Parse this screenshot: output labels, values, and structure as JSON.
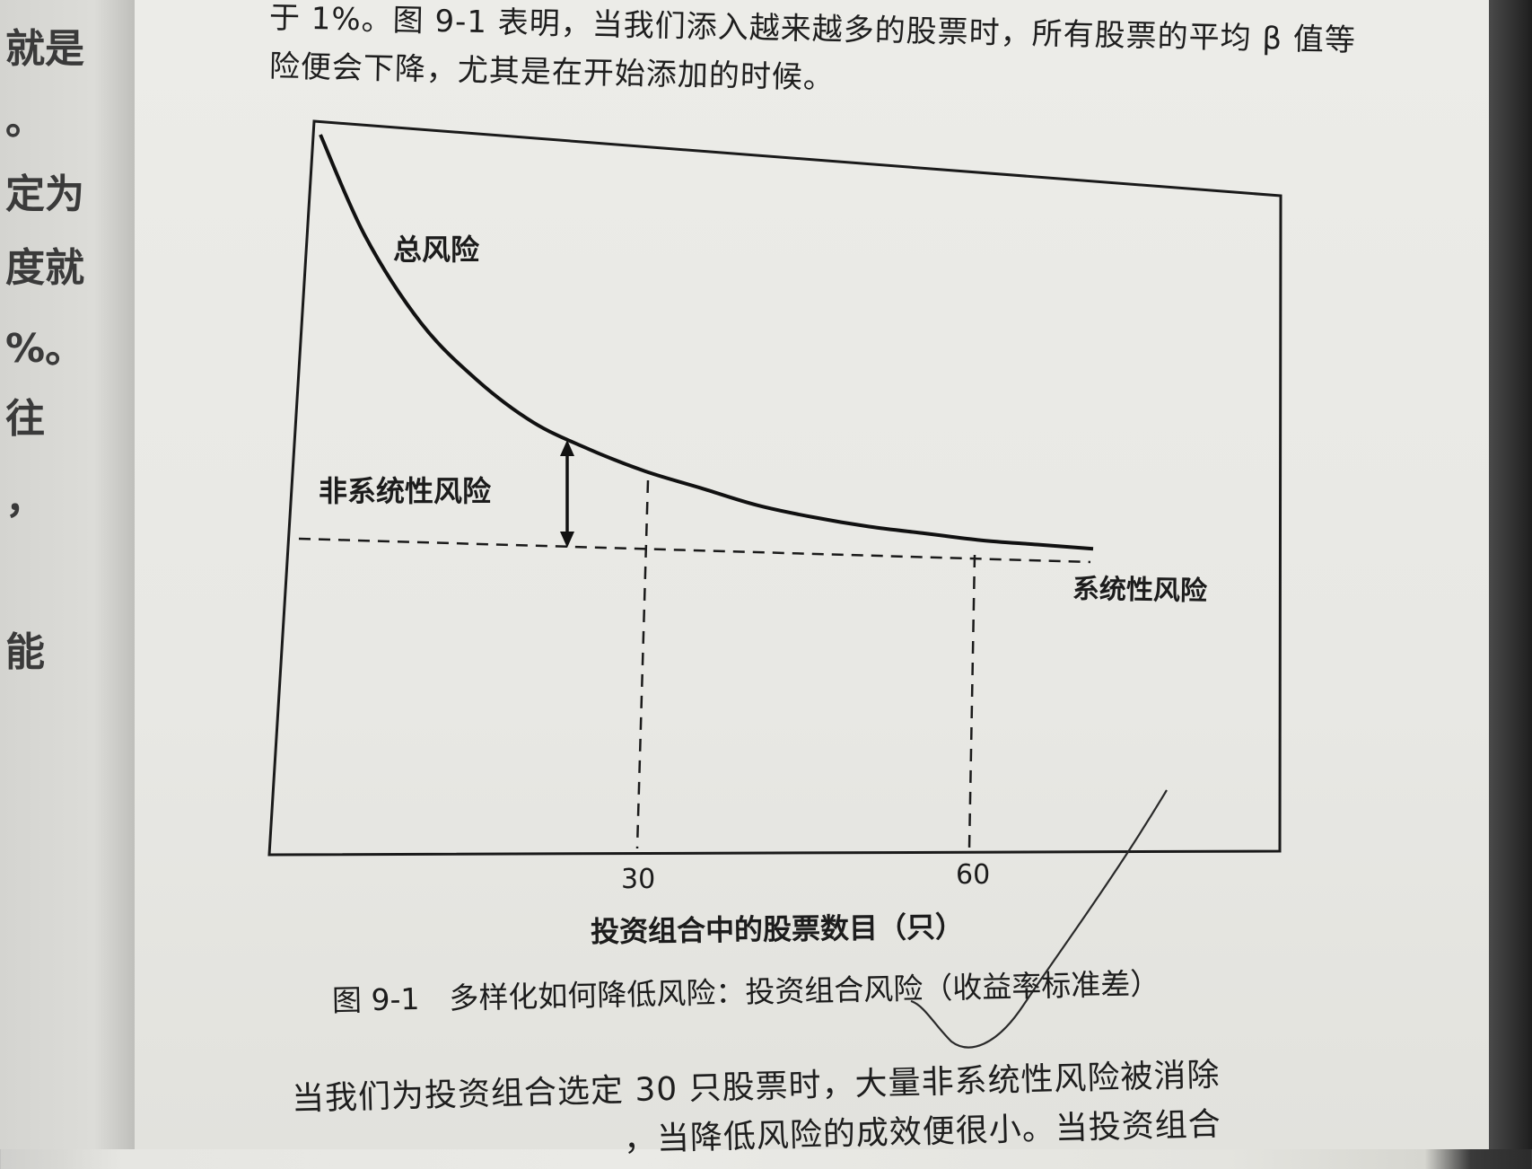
{
  "left_page": {
    "chars": [
      "就是",
      "。",
      "定为",
      "度就",
      "%。",
      "往",
      "，",
      "能"
    ]
  },
  "body_text": {
    "line1": "于 1%。图 9-1 表明，当我们添入越来越多的股票时，所有股票的平均 β 值等",
    "line2": "险便会下降，尤其是在开始添加的时候。",
    "line3": "当我们为投资组合选定 30 只股票时，大量非系统性风险被消除",
    "line4": "　　　　　　　　　　，当降低风险的成效便很小。当投资组合"
  },
  "figure": {
    "labels": {
      "total_risk": "总风险",
      "unsystematic_risk": "非系统性风险",
      "systematic_risk": "系统性风险"
    },
    "x_ticks": [
      "30",
      "60"
    ],
    "x_axis_label": "投资组合中的股票数目（只）",
    "caption": "图 9-1　多样化如何降低风险：投资组合风险（收益率标准差）"
  },
  "chart_data": {
    "type": "line",
    "title": "",
    "xlabel": "投资组合中的股票数目（只）",
    "ylabel": "",
    "x_ticks": [
      30,
      60
    ],
    "series": [
      {
        "name": "总风险",
        "x": [
          1,
          5,
          10,
          15,
          20,
          25,
          30,
          35,
          40,
          45,
          50,
          55,
          60,
          65,
          70
        ],
        "y": [
          100,
          80,
          63,
          52,
          44,
          39,
          35,
          32,
          29,
          27,
          25.5,
          24.5,
          23.5,
          23,
          22.5
        ]
      }
    ],
    "systematic_level": 20,
    "annotations": [
      "总风险",
      "非系统性风险",
      "系统性风险"
    ],
    "grid": false
  }
}
